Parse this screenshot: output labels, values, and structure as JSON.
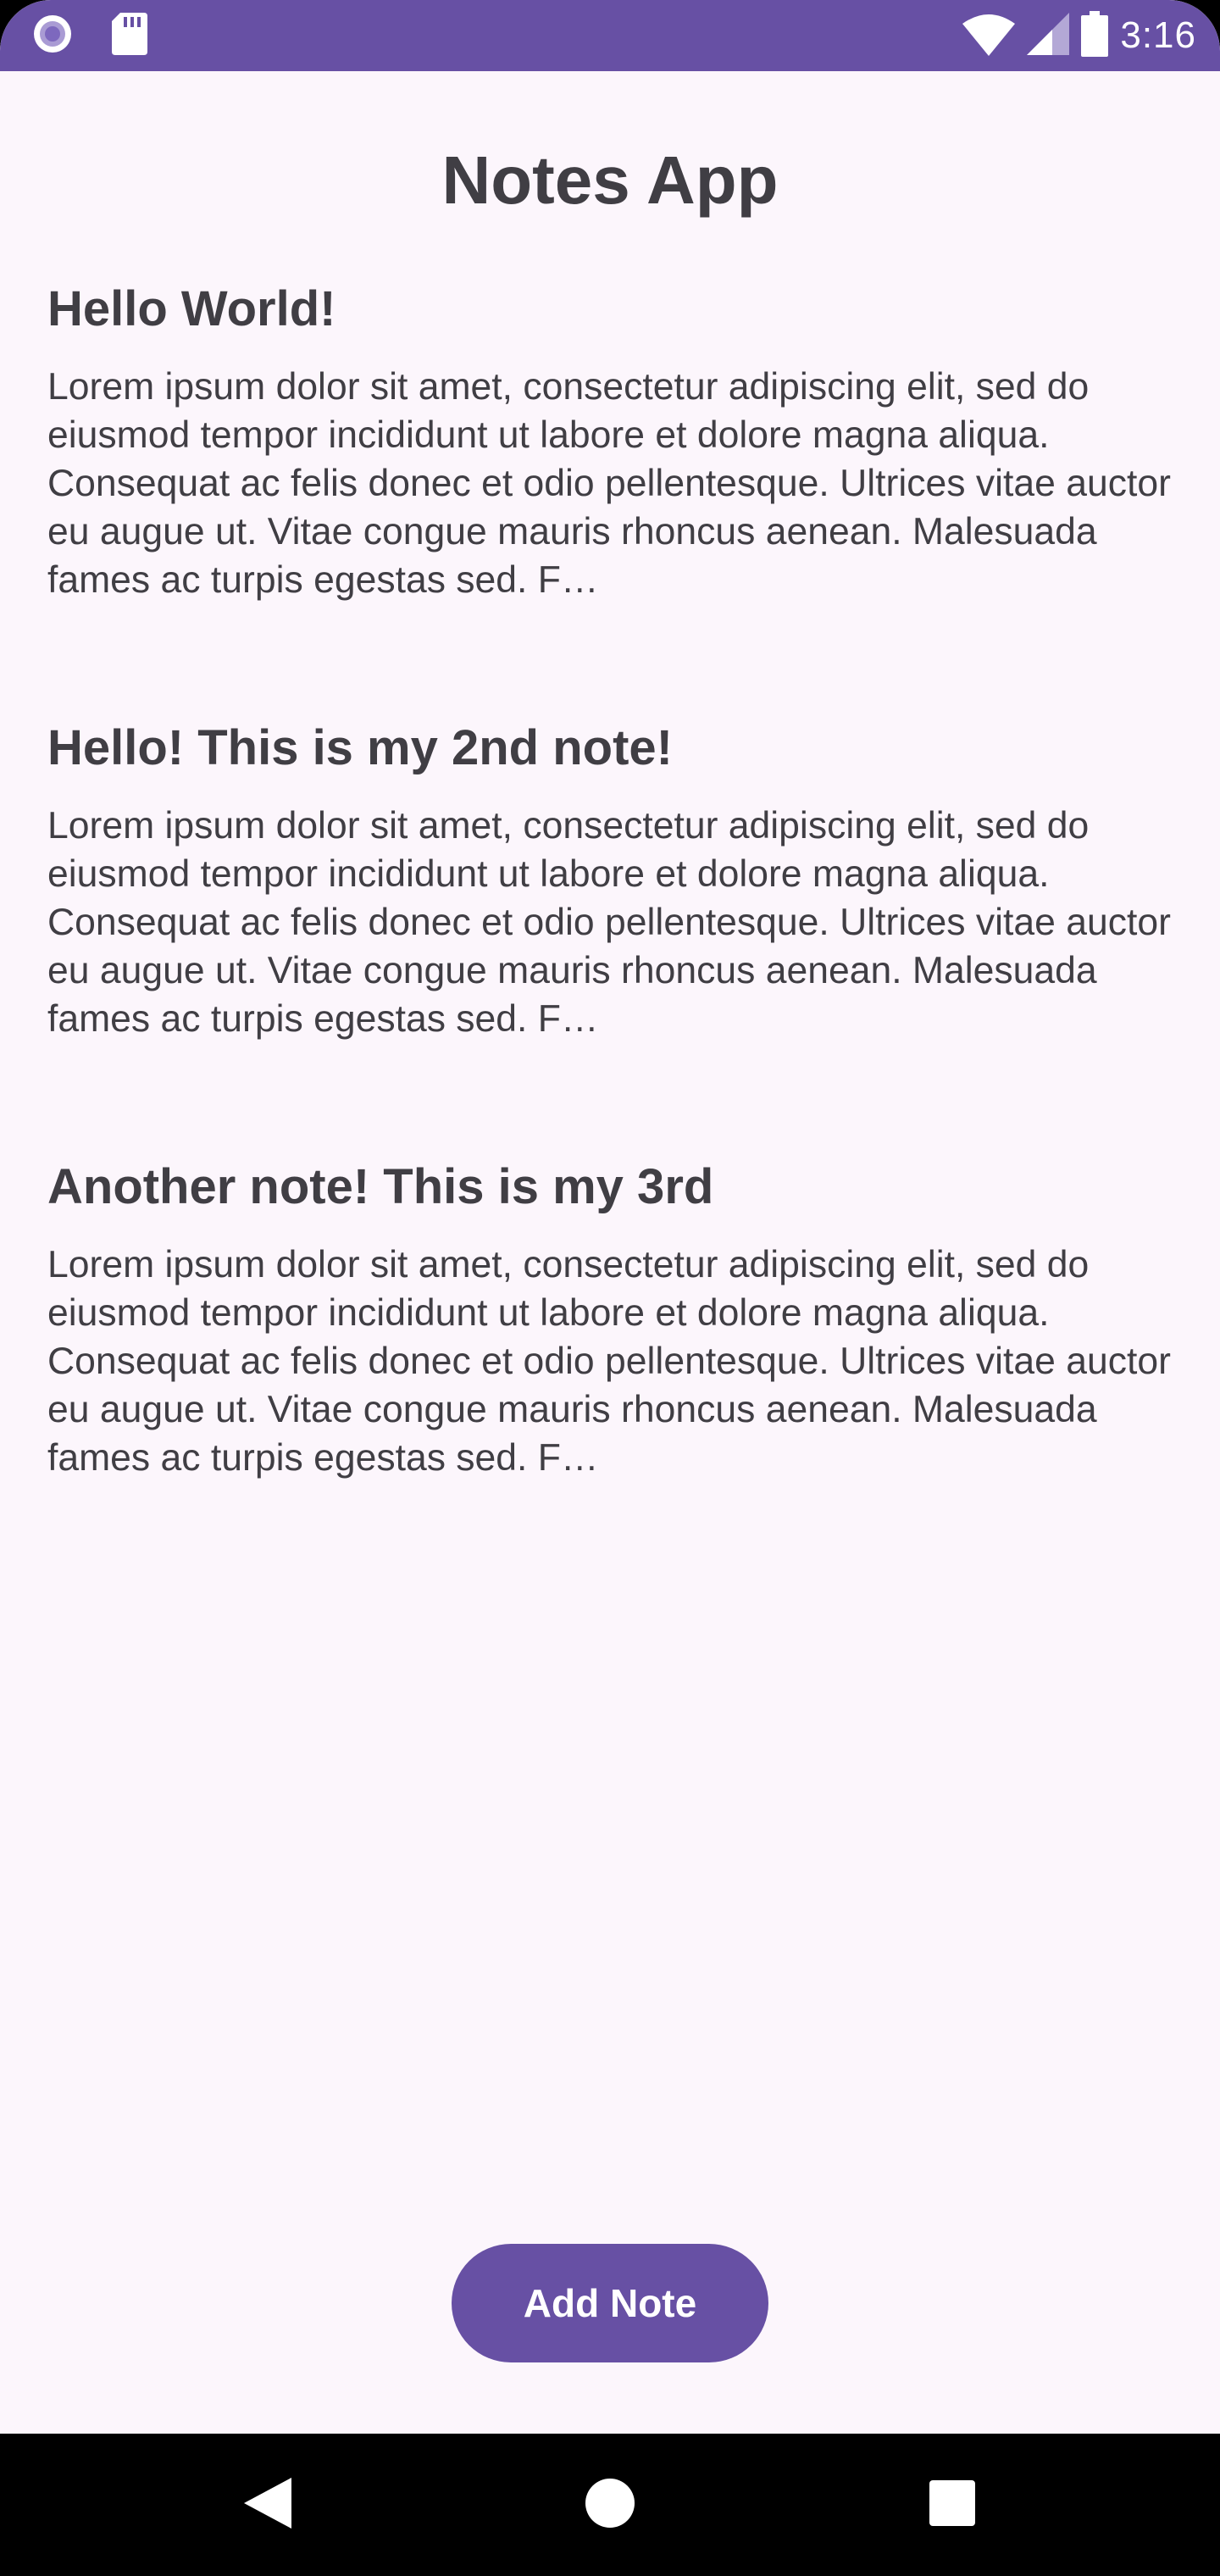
{
  "status_bar": {
    "time": "3:16",
    "icons": [
      "notification-circle-icon",
      "sd-card-icon",
      "wifi-icon",
      "cell-signal-icon",
      "battery-icon"
    ]
  },
  "header": {
    "title": "Notes App"
  },
  "notes": [
    {
      "title": "Hello World!",
      "body": "Lorem ipsum dolor sit amet, consectetur adipiscing elit, sed do eiusmod tempor incididunt ut labore et dolore magna aliqua. Consequat ac felis donec et odio pellentesque. Ultrices vitae auctor eu augue ut. Vitae congue mauris rhoncus aenean. Malesuada fames ac turpis egestas sed. F…"
    },
    {
      "title": "Hello! This is my 2nd note!",
      "body": "Lorem ipsum dolor sit amet, consectetur adipiscing elit, sed do eiusmod tempor incididunt ut labore et dolore magna aliqua. Consequat ac felis donec et odio pellentesque. Ultrices vitae auctor eu augue ut. Vitae congue mauris rhoncus aenean. Malesuada fames ac turpis egestas sed. F…"
    },
    {
      "title": "Another note! This is my 3rd",
      "body": "Lorem ipsum dolor sit amet, consectetur adipiscing elit, sed do eiusmod tempor incididunt ut labore et dolore magna aliqua. Consequat ac felis donec et odio pellentesque. Ultrices vitae auctor eu augue ut. Vitae congue mauris rhoncus aenean. Malesuada fames ac turpis egestas sed. F…"
    }
  ],
  "actions": {
    "add_note_label": "Add Note"
  },
  "nav_bar": {
    "icons": [
      "back-icon",
      "home-icon",
      "recents-icon"
    ]
  },
  "colors": {
    "primary": "#6750A4",
    "background": "#FCF6FC",
    "text": "#403E44",
    "on_primary": "#FFFFFF",
    "nav_bar": "#000000"
  }
}
